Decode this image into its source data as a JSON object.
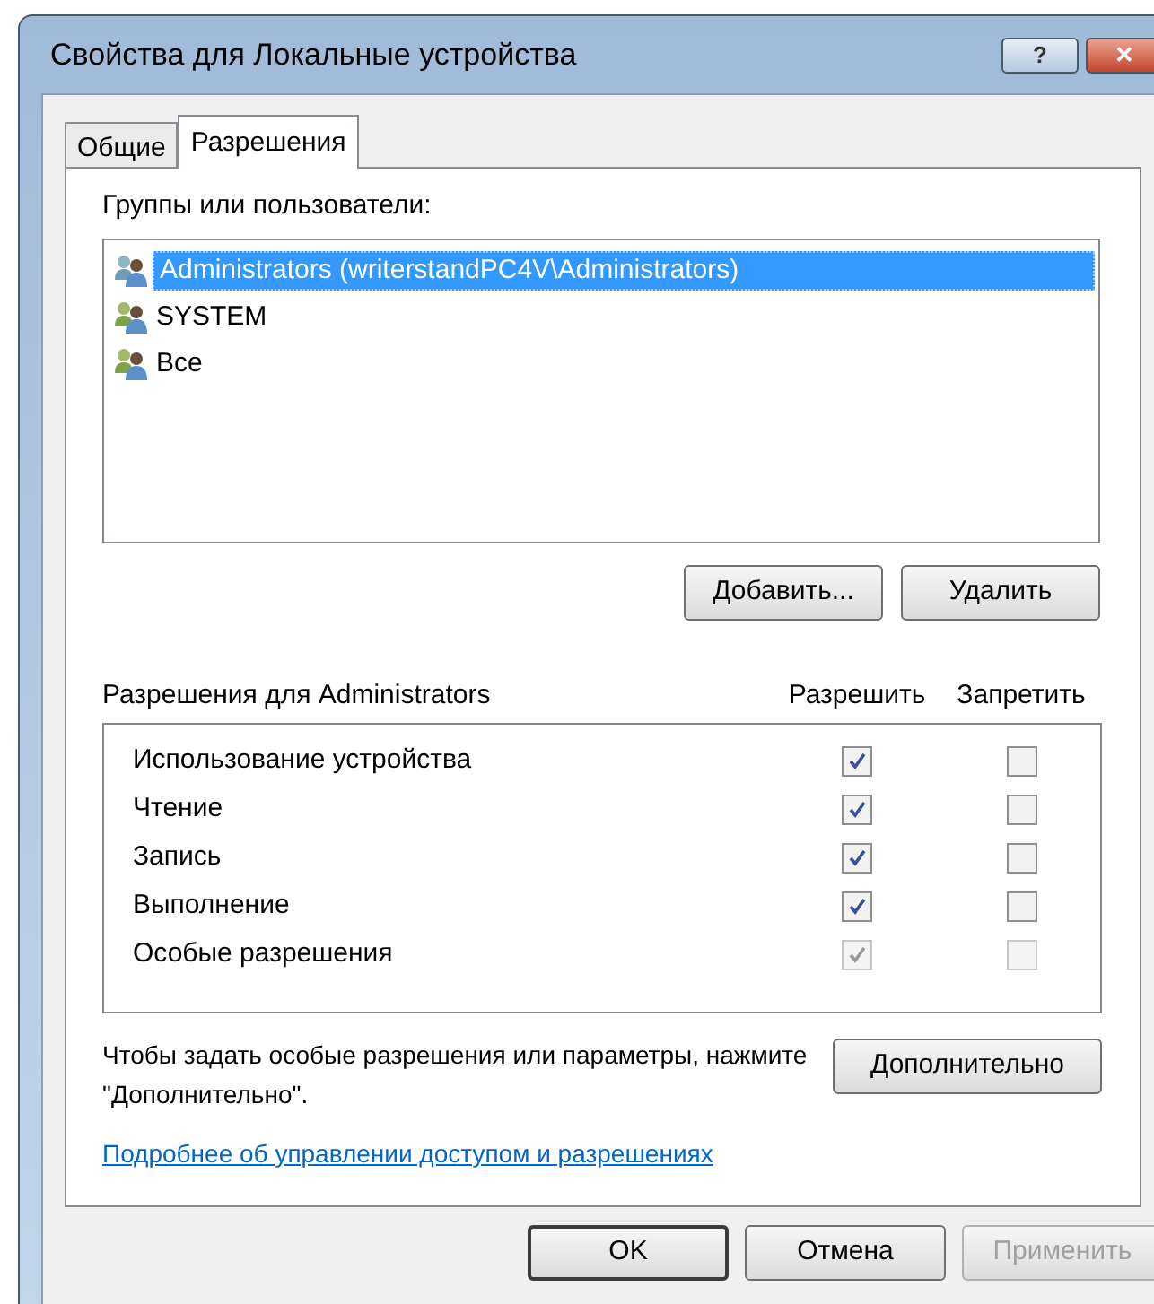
{
  "window": {
    "title": "Свойства для Локальные устройства",
    "buttons": [
      {
        "kind": "help",
        "label": "?"
      },
      {
        "kind": "close",
        "label": "✕"
      }
    ]
  },
  "tabs": [
    {
      "label": "Общие",
      "selected": false
    },
    {
      "label": "Разрешения",
      "selected": true
    }
  ],
  "groups": {
    "label": "Группы или пользователи:",
    "items": [
      {
        "name": "Administrators (writerstandPC4V\\Administrators)",
        "selected": true
      },
      {
        "name": "SYSTEM",
        "selected": false
      },
      {
        "name": "Все",
        "selected": false
      }
    ],
    "buttons": [
      "Добавить...",
      "Удалить"
    ]
  },
  "permissions": {
    "label": "Разрешения для Administrators",
    "columns": [
      "Разрешить",
      "Запретить"
    ],
    "rows": [
      {
        "name": "Использование устройства",
        "allow": true,
        "deny": false,
        "disabled": false
      },
      {
        "name": "Чтение",
        "allow": true,
        "deny": false,
        "disabled": false
      },
      {
        "name": "Запись",
        "allow": true,
        "deny": false,
        "disabled": false
      },
      {
        "name": "Выполнение",
        "allow": true,
        "deny": false,
        "disabled": false
      },
      {
        "name": "Особые разрешения",
        "allow": true,
        "deny": false,
        "disabled": true
      }
    ]
  },
  "advanced": {
    "text": "Чтобы задать особые разрешения или параметры, нажмите \"Дополнительно\".",
    "button": "Дополнительно"
  },
  "link": "Подробнее об управлении доступом и разрешениях",
  "footer_buttons": [
    {
      "label": "OK",
      "disabled": false,
      "default": true
    },
    {
      "label": "Отмена",
      "disabled": false,
      "default": false
    },
    {
      "label": "Применить",
      "disabled": true,
      "default": false
    }
  ]
}
